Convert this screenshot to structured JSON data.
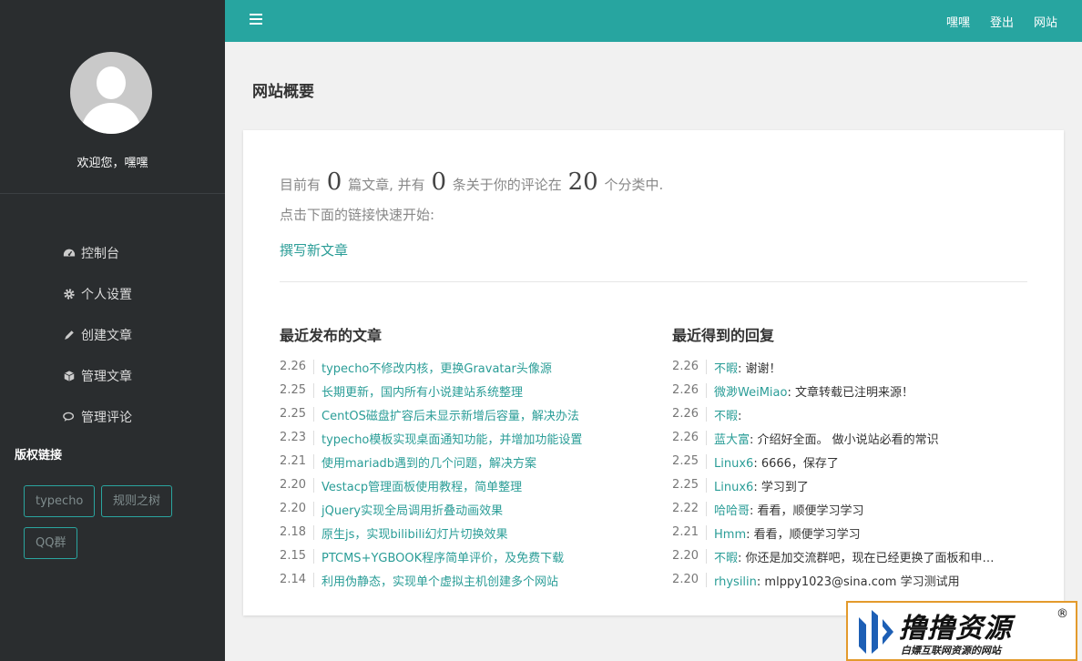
{
  "sidebar": {
    "welcome": "欢迎您，嘿嘿",
    "nav": [
      {
        "label": "控制台",
        "icon": "dashboard-icon"
      },
      {
        "label": "个人设置",
        "icon": "gear-icon"
      },
      {
        "label": "创建文章",
        "icon": "pencil-icon"
      },
      {
        "label": "管理文章",
        "icon": "cube-icon"
      },
      {
        "label": "管理评论",
        "icon": "comments-icon"
      }
    ],
    "copyright_title": "版权链接",
    "tags": [
      "typecho",
      "规则之树",
      "QQ群"
    ]
  },
  "topbar": {
    "links": [
      "嘿嘿",
      "登出",
      "网站"
    ]
  },
  "main": {
    "title": "网站概要",
    "stats": {
      "prefix": "目前有",
      "posts": "0",
      "mid1": "篇文章, 并有",
      "comments": "0",
      "mid2": "条关于你的评论在",
      "categories": "20",
      "suffix": "个分类中."
    },
    "quick_start": "点击下面的链接快速开始:",
    "write_link": "撰写新文章",
    "recent_posts_title": "最近发布的文章",
    "recent_replies_title": "最近得到的回复",
    "recent_posts": [
      {
        "date": "2.26",
        "title": "typecho不修改内核，更换Gravatar头像源"
      },
      {
        "date": "2.25",
        "title": "长期更新，国内所有小说建站系统整理"
      },
      {
        "date": "2.25",
        "title": "CentOS磁盘扩容后未显示新增后容量，解决办法"
      },
      {
        "date": "2.23",
        "title": "typecho模板实现桌面通知功能，并增加功能设置"
      },
      {
        "date": "2.21",
        "title": "使用mariadb遇到的几个问题，解决方案"
      },
      {
        "date": "2.20",
        "title": "Vestacp管理面板使用教程，简单整理"
      },
      {
        "date": "2.20",
        "title": "jQuery实现全局调用折叠动画效果"
      },
      {
        "date": "2.18",
        "title": "原生js，实现bilibili幻灯片切换效果"
      },
      {
        "date": "2.15",
        "title": "PTCMS+YGBOOK程序简单评价，及免费下载"
      },
      {
        "date": "2.14",
        "title": "利用伪静态，实现单个虚拟主机创建多个网站"
      }
    ],
    "recent_replies": [
      {
        "date": "2.26",
        "author": "不暇",
        "text": "谢谢！"
      },
      {
        "date": "2.26",
        "author": "微渺WeiMiao",
        "text": "文章转载已注明来源！"
      },
      {
        "date": "2.26",
        "author": "不暇",
        "text": ""
      },
      {
        "date": "2.26",
        "author": "蓝大富",
        "text": "介绍好全面。 做小说站必看的常识"
      },
      {
        "date": "2.25",
        "author": "Linux6",
        "text": "6666，保存了"
      },
      {
        "date": "2.25",
        "author": "Linux6",
        "text": "学习到了"
      },
      {
        "date": "2.22",
        "author": "哈哈哥",
        "text": "看看，顺便学习学习"
      },
      {
        "date": "2.21",
        "author": "Hmm",
        "text": "看看，顺便学习学习"
      },
      {
        "date": "2.20",
        "author": "不暇",
        "text": "你还是加交流群吧，现在已经更换了面板和申…"
      },
      {
        "date": "2.20",
        "author": "rhysilin",
        "text": "mlppy1023@sina.com 学习测试用"
      }
    ]
  },
  "watermark": {
    "title": "撸撸资源",
    "reg": "®",
    "subtitle": "白嫖互联网资源的网站"
  }
}
